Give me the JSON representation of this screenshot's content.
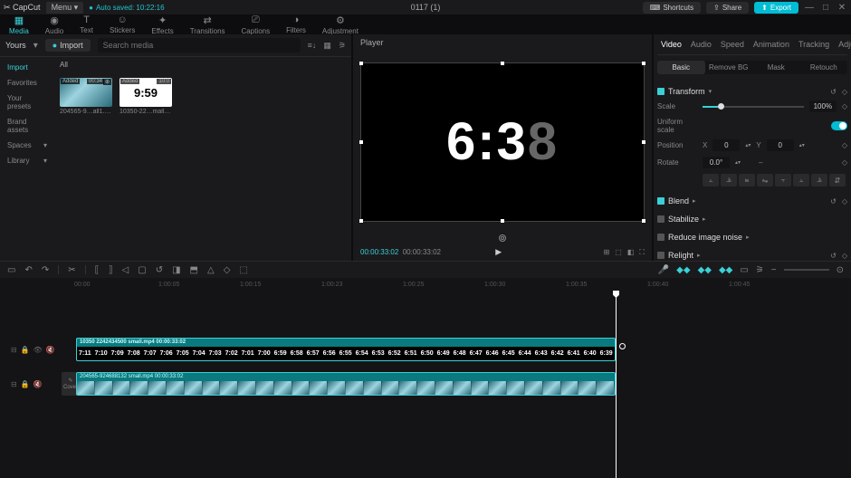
{
  "titlebar": {
    "app": "CapCut",
    "menu": "Menu",
    "autosave": "Auto saved: 10:22:16",
    "title": "0117 (1)",
    "shortcuts": "Shortcuts",
    "share": "Share",
    "export": "Export"
  },
  "top_tabs": [
    {
      "label": "Media",
      "active": true
    },
    {
      "label": "Audio"
    },
    {
      "label": "Text"
    },
    {
      "label": "Stickers"
    },
    {
      "label": "Effects"
    },
    {
      "label": "Transitions"
    },
    {
      "label": "Captions"
    },
    {
      "label": "Filters"
    },
    {
      "label": "Adjustment"
    }
  ],
  "media": {
    "yours": "Yours",
    "import": "Import",
    "search_placeholder": "Search media",
    "all": "All",
    "sidebar": [
      {
        "label": "Import",
        "active": true
      },
      {
        "label": "Favorites"
      },
      {
        "label": "Your presets"
      },
      {
        "label": "Brand assets"
      },
      {
        "label": "Spaces",
        "expand": true
      },
      {
        "label": "Library",
        "expand": true
      }
    ],
    "clips": [
      {
        "badge": "Added",
        "dur": "00:34",
        "name": "204565-9…all1.mp4",
        "type": "wave"
      },
      {
        "badge": "Added",
        "dur": "10:0",
        "name": "10350-22…mall.mp4",
        "type": "counter",
        "display": "9:59"
      }
    ]
  },
  "player": {
    "header": "Player",
    "big_text": "6:3",
    "big_fade": "8",
    "cur": "00:00:33:02",
    "dur": "00:00:33:02"
  },
  "inspector": {
    "tabs": [
      "Video",
      "Audio",
      "Speed",
      "Animation",
      "Tracking",
      "Adjustment"
    ],
    "active_tab": "Video",
    "subtabs": [
      "Basic",
      "Remove BG",
      "Mask",
      "Retouch"
    ],
    "active_sub": "Basic",
    "transform": {
      "title": "Transform",
      "scale": "Scale",
      "scale_pct": "100%",
      "uniform": "Uniform scale",
      "position": "Position",
      "px_l": "X",
      "px_v": "0",
      "py_l": "Y",
      "py_v": "0",
      "rotate": "Rotate",
      "rotate_v": "0.0°"
    },
    "blend": "Blend",
    "stabilize": "Stabilize",
    "reduce": "Reduce image noise",
    "relight": "Relight"
  },
  "timeline": {
    "ruler": [
      "00:00",
      "1:00:05",
      "1:00:15",
      "1:00:23",
      "1:00:25",
      "1:00:30",
      "1:00:35",
      "1:00:40",
      "1:00:45"
    ],
    "track1": {
      "label": "10350 2242434500 small.mp4  00:00:33:02",
      "ticks": [
        "7:11",
        "7:10",
        "7:09",
        "7:08",
        "7:07",
        "7:06",
        "7:05",
        "7:04",
        "7:03",
        "7:02",
        "7:01",
        "7:00",
        "6:59",
        "6:58",
        "6:57",
        "6:56",
        "6:55",
        "6:54",
        "6:53",
        "6:52",
        "6:51",
        "6:50",
        "6:49",
        "6:48",
        "6:47",
        "6:46",
        "6:45",
        "6:44",
        "6:43",
        "6:42",
        "6:41",
        "6:40",
        "6:39"
      ]
    },
    "track2": {
      "label": "204565-924688132 small.mp4  00:00:33:02",
      "cover": "Cover"
    }
  }
}
